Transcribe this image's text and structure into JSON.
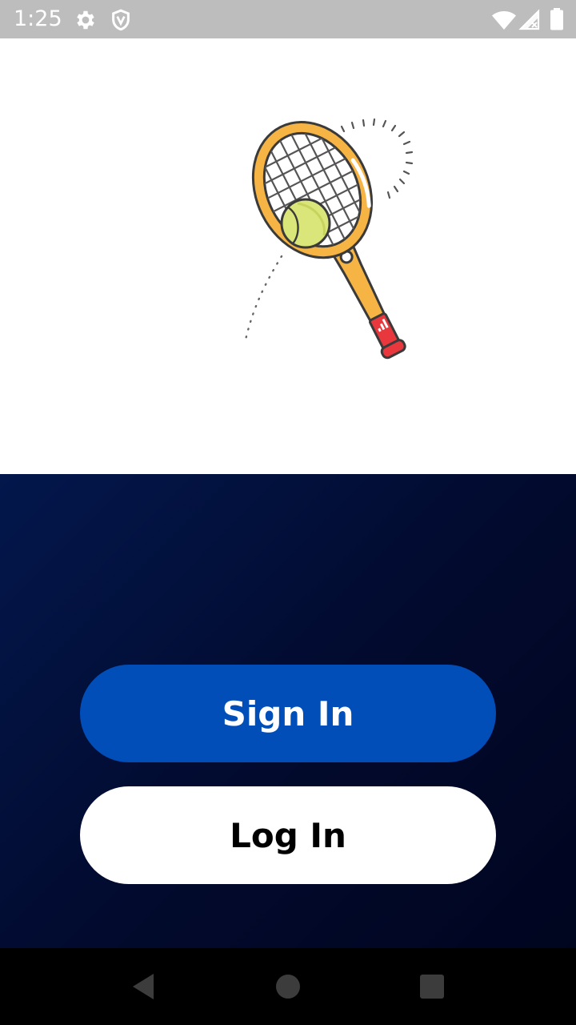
{
  "status_bar": {
    "time": "1:25",
    "icons_left": [
      "gear-icon",
      "shield-icon"
    ],
    "icons_right": [
      "wifi-icon",
      "signal-icon",
      "battery-icon"
    ]
  },
  "hero": {
    "illustration": "tennis-racket-with-ball"
  },
  "actions": {
    "sign_in_label": "Sign In",
    "log_in_label": "Log In"
  },
  "nav_bar": {
    "buttons": [
      "back-icon",
      "home-icon",
      "recents-icon"
    ]
  },
  "colors": {
    "status_bar_bg": "#bdbdbd",
    "panel_gradient_start": "#03174c",
    "panel_gradient_end": "#00051f",
    "sign_in_bg": "#014eb8",
    "log_in_bg": "#ffffff",
    "racket_frame": "#f6b445",
    "racket_grip": "#e8383d",
    "ball": "#dbe67a"
  }
}
